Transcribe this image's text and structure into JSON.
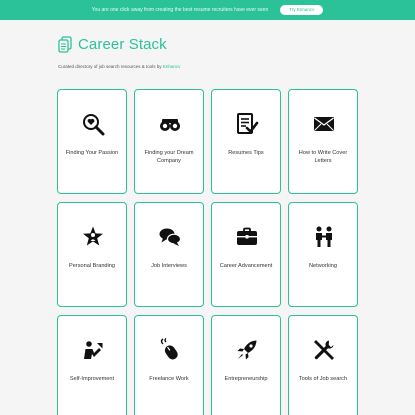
{
  "banner": {
    "text": "You are one click away from creating the best resume recruiters have ever seen",
    "button_label": "Try Enhancv"
  },
  "brand": {
    "title": "Career Stack"
  },
  "tagline": {
    "text": "Curated directory of job search resources & tools by ",
    "link": "Enhancv"
  },
  "cards": [
    {
      "label": "Finding Your Passion",
      "icon": "search-heart-icon"
    },
    {
      "label": "Finding your Dream Company",
      "icon": "binoculars-icon"
    },
    {
      "label": "Resumes Tips",
      "icon": "resume-check-icon"
    },
    {
      "label": "How to Write Cover Letters",
      "icon": "envelope-icon"
    },
    {
      "label": "Personal Branding",
      "icon": "star-person-icon"
    },
    {
      "label": "Job Interviews",
      "icon": "chat-bubbles-icon"
    },
    {
      "label": "Career Advancement",
      "icon": "briefcase-icon"
    },
    {
      "label": "Networking",
      "icon": "people-icon"
    },
    {
      "label": "Self-Improvement",
      "icon": "growth-person-icon"
    },
    {
      "label": "Freelance Work",
      "icon": "mouse-icon"
    },
    {
      "label": "Entrepreneurship",
      "icon": "rocket-icon"
    },
    {
      "label": "Tools of Job search",
      "icon": "tools-icon"
    }
  ]
}
